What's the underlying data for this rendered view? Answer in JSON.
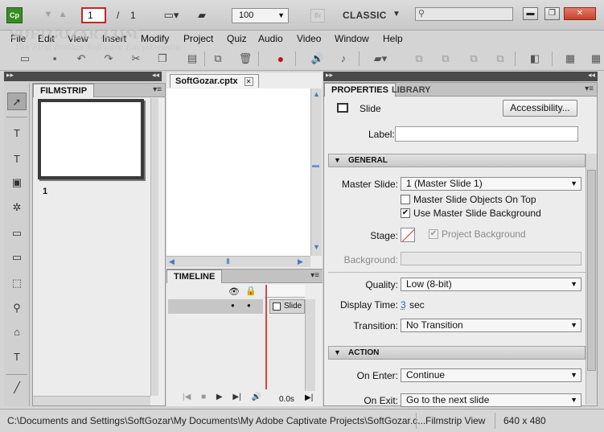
{
  "app": {
    "icon_label": "Cp"
  },
  "slide_nav": {
    "current": "1",
    "separator": "/",
    "total": "1"
  },
  "zoom": {
    "value": "100"
  },
  "br_button": "Br",
  "workspace": {
    "label": "CLASSIC"
  },
  "window_controls": {
    "minimize": "▬",
    "restore": "❐",
    "close": "✕"
  },
  "watermark": {
    "line1": "SOFTGOZAR.COM",
    "line2": "The First Iranian Software Encyclopedia"
  },
  "menu": [
    "File",
    "Edit",
    "View",
    "Insert",
    "Modify",
    "Project",
    "Quiz",
    "Audio",
    "Video",
    "Window",
    "Help"
  ],
  "filmstrip": {
    "tab": "FILMSTRIP",
    "slide_number": "1"
  },
  "document": {
    "tab": "SoftGozar.cptx",
    "close": "✕"
  },
  "timeline": {
    "tab": "TIMELINE",
    "slide_bar": "Slide",
    "time": "0.0s"
  },
  "properties": {
    "tabs": [
      "PROPERTIES",
      "LIBRARY"
    ],
    "object_type": "Slide",
    "accessibility_button": "Accessibility...",
    "label_field": {
      "label": "Label:",
      "value": ""
    },
    "general": {
      "header": "GENERAL",
      "master_slide": {
        "label": "Master Slide:",
        "value": "1 (Master Slide 1)"
      },
      "master_objects_on_top": {
        "label": "Master Slide Objects On Top",
        "checked": false
      },
      "use_master_background": {
        "label": "Use Master Slide Background",
        "checked": true
      },
      "stage": {
        "label": "Stage:"
      },
      "project_background": {
        "label": "Project Background",
        "checked": true,
        "disabled": true
      },
      "background": {
        "label": "Background:"
      },
      "quality": {
        "label": "Quality:",
        "value": "Low (8-bit)"
      },
      "display_time": {
        "label": "Display Time:",
        "value": "3",
        "unit": "sec"
      },
      "transition": {
        "label": "Transition:",
        "value": "No Transition"
      }
    },
    "action": {
      "header": "ACTION",
      "on_enter": {
        "label": "On Enter:",
        "value": "Continue"
      },
      "on_exit": {
        "label": "On Exit:",
        "value": "Go to the next slide"
      }
    }
  },
  "status": {
    "path": "C:\\Documents and Settings\\SoftGozar\\My Documents\\My Adobe Captivate Projects\\SoftGozar.c...",
    "view": "Filmstrip View",
    "resolution": "640 x 480"
  },
  "colors": {
    "slide_number_border": "#c0282c",
    "record_button": "#c0141a",
    "app_icon": "#3a8a2a",
    "playhead": "#dd4444"
  }
}
